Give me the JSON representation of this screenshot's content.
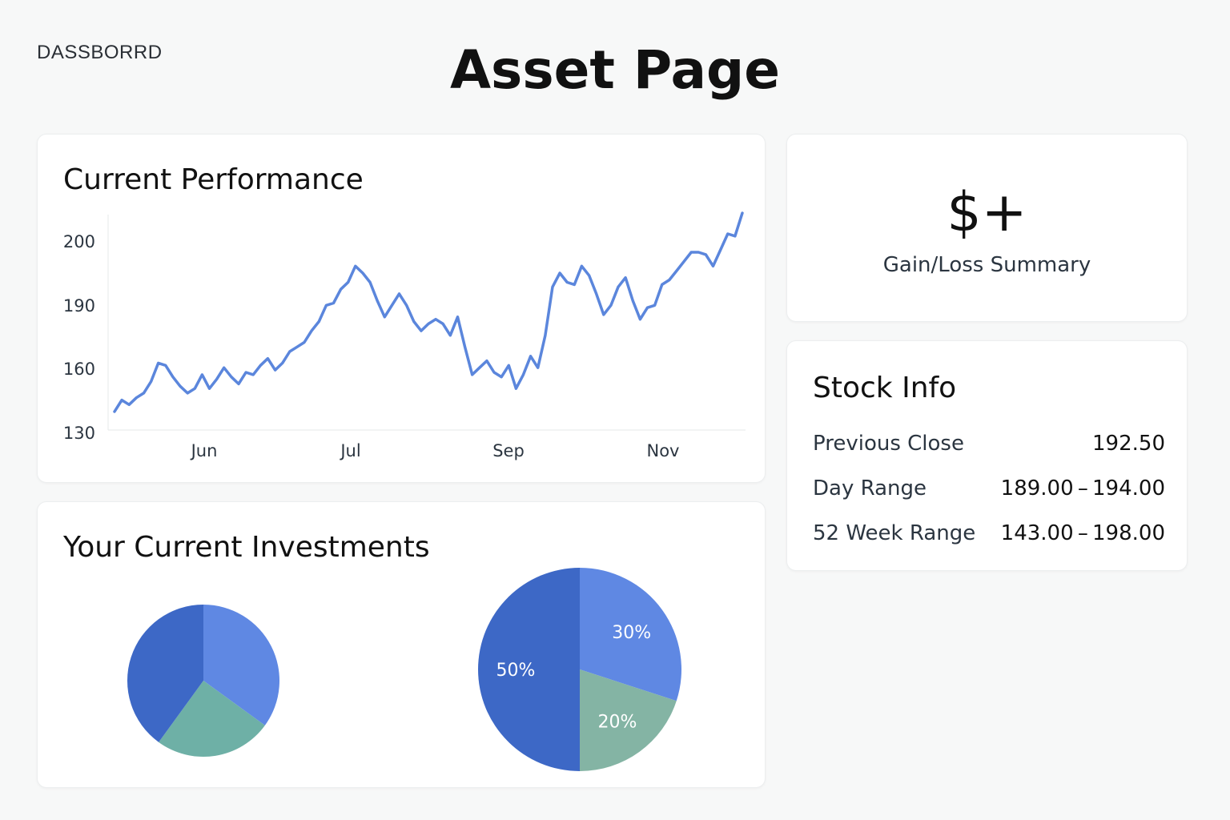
{
  "header": {
    "brand": "DASSBORRD",
    "title": "Asset Page"
  },
  "performance": {
    "title": "Current Performance"
  },
  "investments": {
    "title": "Your Current Investments"
  },
  "gain": {
    "value": "$+",
    "label": "Gain/Loss Summary"
  },
  "stock_info": {
    "title": "Stock Info",
    "rows": [
      {
        "label": "Previous Close",
        "value": "192.50"
      },
      {
        "label": "Day Range",
        "value": "189.00 – 194.00"
      },
      {
        "label": "52 Week Range",
        "value": "143.00 – 198.00"
      }
    ]
  },
  "colors": {
    "line": "#5b86dc",
    "pie_blue_dark": "#3d68c6",
    "pie_blue_light": "#5f88e3",
    "pie_teal": "#6eb0a6",
    "pie_sage": "#84b4a4"
  },
  "chart_data": [
    {
      "type": "line",
      "title": "Current Performance",
      "ytick_labels": [
        "130",
        "160",
        "190",
        "200"
      ],
      "xtick_labels": [
        "Jun",
        "Jul",
        "Sep",
        "Nov"
      ],
      "series": [
        {
          "values": [
            130,
            135,
            133,
            136,
            138,
            143,
            151,
            150,
            145,
            141,
            138,
            140,
            146,
            140,
            144,
            149,
            145,
            142,
            147,
            146,
            150,
            153,
            148,
            151,
            156,
            158,
            160,
            165,
            169,
            176,
            177,
            183,
            186,
            193,
            190,
            186,
            178,
            171,
            176,
            181,
            176,
            169,
            165,
            168,
            170,
            168,
            163,
            171,
            158,
            146,
            149,
            152,
            147,
            145,
            150,
            140,
            146,
            154,
            149,
            163,
            184,
            190,
            186,
            185,
            193,
            189,
            181,
            172,
            176,
            184,
            188,
            178,
            170,
            175,
            176,
            185,
            187,
            191,
            195,
            199,
            199,
            198,
            193,
            200,
            207,
            206,
            216
          ]
        }
      ]
    },
    {
      "type": "pie",
      "values": [
        35,
        25,
        40
      ],
      "slice_labels": [
        "",
        "",
        ""
      ]
    },
    {
      "type": "pie",
      "values": [
        30,
        20,
        50
      ],
      "slice_labels": [
        "30%",
        "20%",
        "50%"
      ]
    }
  ]
}
